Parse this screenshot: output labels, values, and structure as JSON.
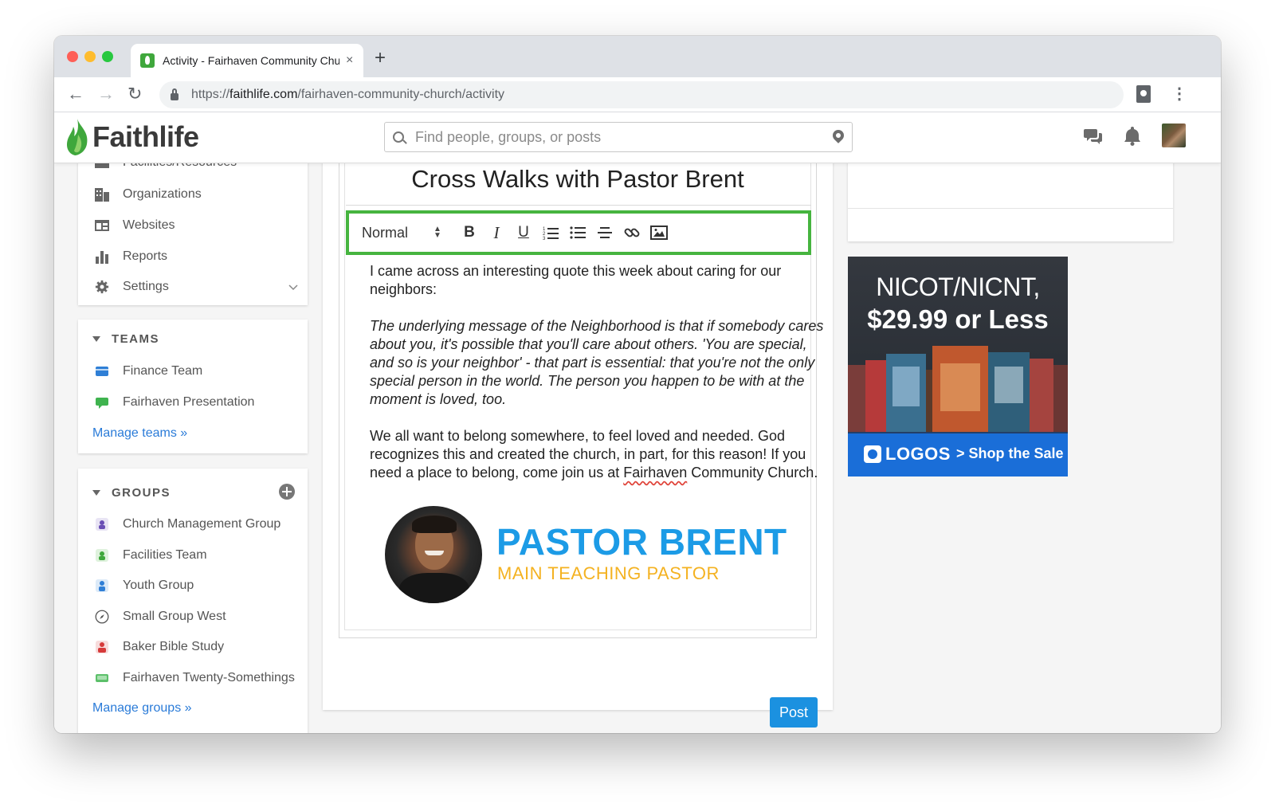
{
  "browser": {
    "tab_title": "Activity - Fairhaven Community Church",
    "tab_close": "×",
    "new_tab": "+",
    "url_scheme": "https://",
    "url_host": "faithlife.com",
    "url_path": "/fairhaven-community-church/activity"
  },
  "header": {
    "logo": "Faithlife",
    "search_placeholder": "Find people, groups, or posts"
  },
  "sidebar": {
    "admin_items": [
      {
        "label": "Facilities/Resources",
        "icon": "building-icon"
      },
      {
        "label": "Organizations",
        "icon": "organization-icon"
      },
      {
        "label": "Websites",
        "icon": "website-icon"
      },
      {
        "label": "Reports",
        "icon": "bar-chart-icon"
      },
      {
        "label": "Settings",
        "icon": "gear-icon"
      }
    ],
    "teams": {
      "heading": "TEAMS",
      "items": [
        {
          "label": "Finance Team",
          "icon": "finance-team-icon"
        },
        {
          "label": "Fairhaven Presentation",
          "icon": "presentation-team-icon"
        }
      ],
      "manage": "Manage teams »"
    },
    "groups": {
      "heading": "GROUPS",
      "items": [
        {
          "label": "Church Management Group",
          "icon": "church-management-icon"
        },
        {
          "label": "Facilities Team",
          "icon": "facilities-team-icon"
        },
        {
          "label": "Youth Group",
          "icon": "youth-group-icon"
        },
        {
          "label": "Small Group West",
          "icon": "compass-icon"
        },
        {
          "label": "Baker Bible Study",
          "icon": "bible-study-icon"
        },
        {
          "label": "Fairhaven Twenty-Somethings",
          "icon": "twenty-somethings-icon"
        }
      ],
      "manage": "Manage groups »"
    }
  },
  "editor": {
    "title": "Cross Walks with Pastor Brent",
    "format": "Normal",
    "toolbar": [
      "B",
      "I",
      "U"
    ],
    "p1": "I came across an interesting quote this week about caring for our neighbors:",
    "quote": "The underlying message of the Neighborhood is that if somebody cares about you, it's possible that you'll care about others. 'You are special, and so is your neighbor' - that part is essential: that you're not the only special person in the world. The person you happen to be with at the moment is loved, too.",
    "p3_before": "We all want to belong somewhere, to feel loved and needed. God recognizes this and created the church, in part, for this reason! If you need a place to belong, come join us at ",
    "p3_misspelled": "Fairhaven",
    "p3_after": " Community Church.",
    "pastor_name": "PASTOR BRENT",
    "pastor_role": "MAIN TEACHING PASTOR",
    "post_button": "Post"
  },
  "ad": {
    "line1": "NICOT/NICNT,",
    "line2": "$29.99 or Less",
    "brand": "LOGOS",
    "cta": "> Shop the Sale"
  },
  "colors": {
    "accent_green": "#46b43f",
    "link_blue": "#2a7bd8",
    "post_blue": "#1b91e0",
    "pastor_blue": "#1c9be6",
    "pastor_gold": "#f4b221"
  }
}
